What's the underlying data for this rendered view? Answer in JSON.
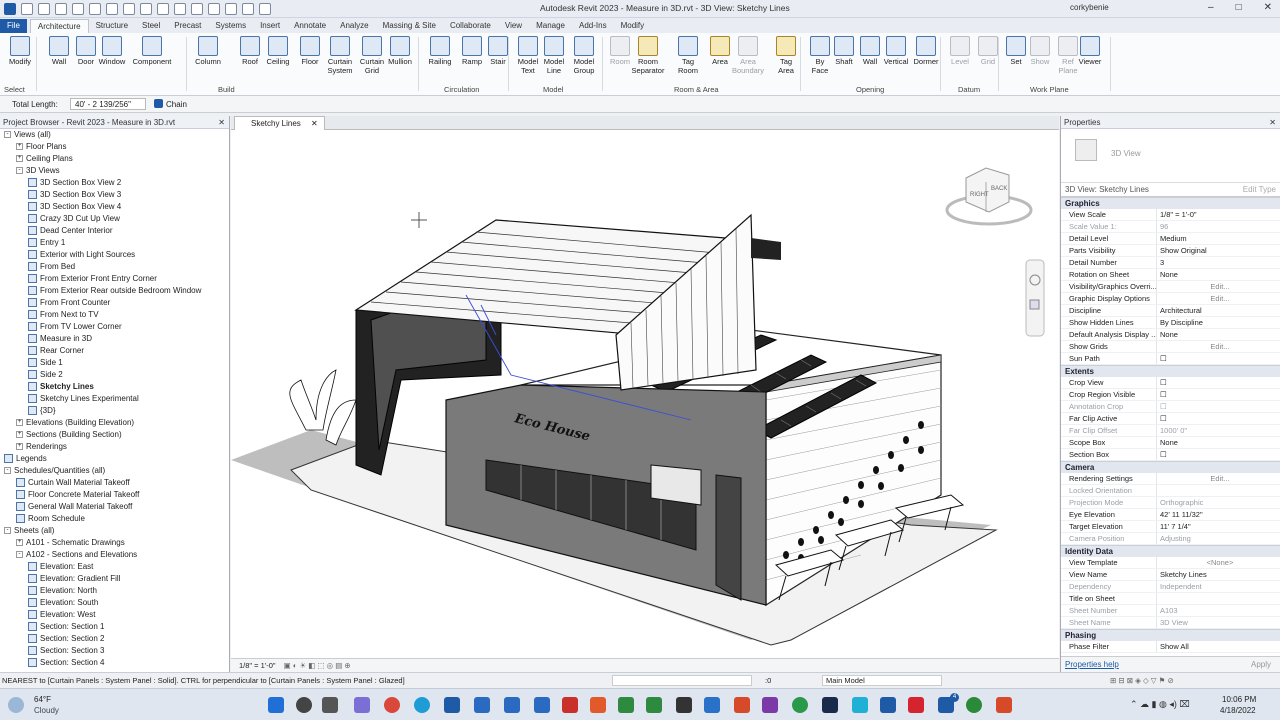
{
  "window": {
    "title": "Autodesk Revit 2023 - Measure in 3D.rvt - 3D View: Sketchy Lines",
    "user": "corkybenie"
  },
  "tabs": [
    "File",
    "Architecture",
    "Structure",
    "Steel",
    "Precast",
    "Systems",
    "Insert",
    "Annotate",
    "Analyze",
    "Massing & Site",
    "Collaborate",
    "View",
    "Manage",
    "Add-Ins",
    "Modify"
  ],
  "ribbon": {
    "tools": [
      {
        "id": "modify",
        "label": "Modify"
      },
      {
        "id": "wall",
        "label": "Wall"
      },
      {
        "id": "door",
        "label": "Door"
      },
      {
        "id": "window",
        "label": "Window"
      },
      {
        "id": "component",
        "label": "Component"
      },
      {
        "id": "column",
        "label": "Column"
      },
      {
        "id": "roof",
        "label": "Roof"
      },
      {
        "id": "ceiling",
        "label": "Ceiling"
      },
      {
        "id": "floor",
        "label": "Floor"
      },
      {
        "id": "curtain-system",
        "label": "Curtain\nSystem"
      },
      {
        "id": "curtain-grid",
        "label": "Curtain\nGrid"
      },
      {
        "id": "mullion",
        "label": "Mullion"
      },
      {
        "id": "railing",
        "label": "Railing"
      },
      {
        "id": "ramp",
        "label": "Ramp"
      },
      {
        "id": "stair",
        "label": "Stair"
      },
      {
        "id": "model-text",
        "label": "Model\nText"
      },
      {
        "id": "model-line",
        "label": "Model\nLine"
      },
      {
        "id": "model-group",
        "label": "Model\nGroup"
      },
      {
        "id": "room",
        "label": "Room"
      },
      {
        "id": "room-separator",
        "label": "Room\nSeparator"
      },
      {
        "id": "tag-room",
        "label": "Tag\nRoom"
      },
      {
        "id": "area",
        "label": "Area"
      },
      {
        "id": "area-boundary",
        "label": "Area\nBoundary"
      },
      {
        "id": "tag-area",
        "label": "Tag\nArea"
      },
      {
        "id": "by-face",
        "label": "By\nFace"
      },
      {
        "id": "shaft",
        "label": "Shaft"
      },
      {
        "id": "wall-opening",
        "label": "Wall"
      },
      {
        "id": "vertical",
        "label": "Vertical"
      },
      {
        "id": "dormer",
        "label": "Dormer"
      },
      {
        "id": "level",
        "label": "Level"
      },
      {
        "id": "grid",
        "label": "Grid"
      },
      {
        "id": "set",
        "label": "Set"
      },
      {
        "id": "show",
        "label": "Show"
      },
      {
        "id": "ref-plane",
        "label": "Ref\nPlane"
      },
      {
        "id": "viewer",
        "label": "Viewer"
      }
    ],
    "groups": [
      "Select",
      "Build",
      "Circulation",
      "Model",
      "Room & Area",
      "Opening",
      "Datum",
      "Work Plane"
    ]
  },
  "optionsbar": {
    "length_label": "Total Length:",
    "length_value": "40' - 2 139/256\"",
    "chain_label": "Chain"
  },
  "browser": {
    "title": "Project Browser - Revit 2023 - Measure in 3D.rvt",
    "rows": [
      {
        "t": "Views (all)",
        "d": 0,
        "ex": "-"
      },
      {
        "t": "Floor Plans",
        "d": 1,
        "ex": "+"
      },
      {
        "t": "Ceiling Plans",
        "d": 1,
        "ex": "+"
      },
      {
        "t": "3D Views",
        "d": 1,
        "ex": "-"
      },
      {
        "t": "3D Section Box View 2",
        "d": 2,
        "i": 1
      },
      {
        "t": "3D Section Box View 3",
        "d": 2,
        "i": 1
      },
      {
        "t": "3D Section Box View 4",
        "d": 2,
        "i": 1
      },
      {
        "t": "Crazy 3D Cut Up View",
        "d": 2,
        "i": 1
      },
      {
        "t": "Dead Center Interior",
        "d": 2,
        "i": 1
      },
      {
        "t": "Entry 1",
        "d": 2,
        "i": 1
      },
      {
        "t": "Exterior with Light Sources",
        "d": 2,
        "i": 1
      },
      {
        "t": "From Bed",
        "d": 2,
        "i": 1
      },
      {
        "t": "From Exterior Front Entry Corner",
        "d": 2,
        "i": 1
      },
      {
        "t": "From Exterior Rear outside Bedroom Window",
        "d": 2,
        "i": 1
      },
      {
        "t": "From Front Counter",
        "d": 2,
        "i": 1
      },
      {
        "t": "From Next to TV",
        "d": 2,
        "i": 1
      },
      {
        "t": "From TV Lower Corner",
        "d": 2,
        "i": 1
      },
      {
        "t": "Measure in 3D",
        "d": 2,
        "i": 1
      },
      {
        "t": "Rear Corner",
        "d": 2,
        "i": 1
      },
      {
        "t": "Side 1",
        "d": 2,
        "i": 1
      },
      {
        "t": "Side 2",
        "d": 2,
        "i": 1
      },
      {
        "t": "Sketchy Lines",
        "d": 2,
        "i": 1,
        "b": 1
      },
      {
        "t": "Sketchy Lines Experimental",
        "d": 2,
        "i": 1
      },
      {
        "t": "{3D}",
        "d": 2,
        "i": 1
      },
      {
        "t": "Elevations (Building Elevation)",
        "d": 1,
        "ex": "+"
      },
      {
        "t": "Sections (Building Section)",
        "d": 1,
        "ex": "+"
      },
      {
        "t": "Renderings",
        "d": 1,
        "ex": "+"
      },
      {
        "t": "Legends",
        "d": 0,
        "i": 1
      },
      {
        "t": "Schedules/Quantities (all)",
        "d": 0,
        "ex": "-"
      },
      {
        "t": "Curtain Wall Material Takeoff",
        "d": 1,
        "i": 1
      },
      {
        "t": "Floor Concrete Material Takeoff",
        "d": 1,
        "i": 1
      },
      {
        "t": "General Wall Material Takeoff",
        "d": 1,
        "i": 1
      },
      {
        "t": "Room Schedule",
        "d": 1,
        "i": 1
      },
      {
        "t": "Sheets (all)",
        "d": 0,
        "ex": "-"
      },
      {
        "t": "A101 - Schematic Drawings",
        "d": 1,
        "ex": "+"
      },
      {
        "t": "A102 - Sections and Elevations",
        "d": 1,
        "ex": "-"
      },
      {
        "t": "Elevation: East",
        "d": 2,
        "i": 1
      },
      {
        "t": "Elevation: Gradient Fill",
        "d": 2,
        "i": 1
      },
      {
        "t": "Elevation: North",
        "d": 2,
        "i": 1
      },
      {
        "t": "Elevation: South",
        "d": 2,
        "i": 1
      },
      {
        "t": "Elevation: West",
        "d": 2,
        "i": 1
      },
      {
        "t": "Section: Section 1",
        "d": 2,
        "i": 1
      },
      {
        "t": "Section: Section 2",
        "d": 2,
        "i": 1
      },
      {
        "t": "Section: Section 3",
        "d": 2,
        "i": 1
      },
      {
        "t": "Section: Section 4",
        "d": 2,
        "i": 1
      }
    ]
  },
  "view": {
    "tab": "Sketchy Lines",
    "scale": "1/8\" = 1'-0\"",
    "sign": "Eco House",
    "viewcube": [
      "RIGHT",
      "BACK"
    ]
  },
  "properties": {
    "title": "Properties",
    "type": "3D View",
    "selector": "3D View: Sketchy Lines",
    "edit_type": "Edit Type",
    "sections": [
      {
        "name": "Graphics",
        "rows": [
          [
            "View Scale",
            "1/8\" = 1'-0\""
          ],
          [
            "Scale Value    1:",
            "96",
            1
          ],
          [
            "Detail Level",
            "Medium"
          ],
          [
            "Parts Visibility",
            "Show Original"
          ],
          [
            "Detail Number",
            "3"
          ],
          [
            "Rotation on Sheet",
            "None"
          ],
          [
            "Visibility/Graphics Overri...",
            "Edit...",
            0,
            1
          ],
          [
            "Graphic Display Options",
            "Edit...",
            0,
            1
          ],
          [
            "Discipline",
            "Architectural"
          ],
          [
            "Show Hidden Lines",
            "By Discipline"
          ],
          [
            "Default Analysis Display ...",
            "None"
          ],
          [
            "Show Grids",
            "Edit...",
            0,
            1
          ],
          [
            "Sun Path",
            "☐"
          ]
        ]
      },
      {
        "name": "Extents",
        "rows": [
          [
            "Crop View",
            "☐"
          ],
          [
            "Crop Region Visible",
            "☐"
          ],
          [
            "Annotation Crop",
            "☐",
            1
          ],
          [
            "Far Clip Active",
            "☐"
          ],
          [
            "Far Clip Offset",
            "1000'  0\"",
            1
          ],
          [
            "Scope Box",
            "None"
          ],
          [
            "Section Box",
            "☐"
          ]
        ]
      },
      {
        "name": "Camera",
        "rows": [
          [
            "Rendering Settings",
            "Edit...",
            0,
            1
          ],
          [
            "Locked Orientation",
            "",
            1
          ],
          [
            "Projection Mode",
            "Orthographic",
            1
          ],
          [
            "Eye Elevation",
            "42'  11 11/32\""
          ],
          [
            "Target Elevation",
            "11'  7 1/4\""
          ],
          [
            "Camera Position",
            "Adjusting",
            1
          ]
        ]
      },
      {
        "name": "Identity Data",
        "rows": [
          [
            "View Template",
            "<None>",
            0,
            1
          ],
          [
            "View Name",
            "Sketchy Lines"
          ],
          [
            "Dependency",
            "Independent",
            1
          ],
          [
            "Title on Sheet",
            ""
          ],
          [
            "Sheet Number",
            "A103",
            1
          ],
          [
            "Sheet Name",
            "3D View",
            1
          ]
        ]
      },
      {
        "name": "Phasing",
        "rows": [
          [
            "Phase Filter",
            "Show All"
          ]
        ]
      }
    ],
    "help": "Properties help",
    "apply": "Apply"
  },
  "status": {
    "text": "NEAREST  to [Curtain Panels : System Panel : Solid].  CTRL for perpendicular to [Curtain Panels : System Panel : Glazed]",
    "zero": ":0",
    "model": "Main Model"
  },
  "taskbar": {
    "temp": "64°F",
    "weather": "Cloudy",
    "time": "10:06 PM",
    "date": "4/18/2022",
    "badge": "4"
  },
  "colors": {
    "file_tab": "#1f5aa6",
    "accent": "#4b74a8"
  }
}
